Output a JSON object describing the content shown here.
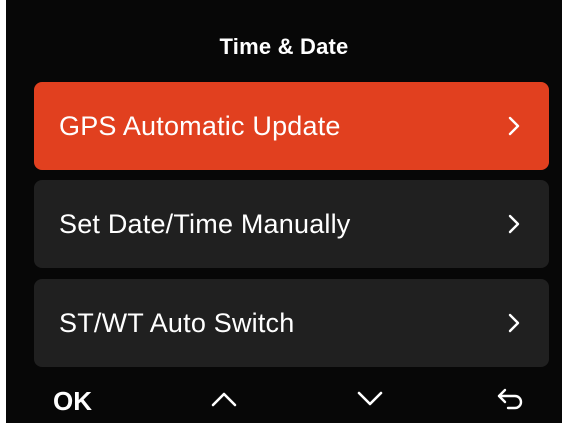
{
  "header": {
    "title": "Time & Date"
  },
  "menu": {
    "items": [
      {
        "label": "GPS Automatic Update",
        "selected": true
      },
      {
        "label": "Set Date/Time Manually",
        "selected": false
      },
      {
        "label": "ST/WT Auto Switch",
        "selected": false
      }
    ]
  },
  "softkeys": {
    "ok_label": "OK",
    "up_icon": "chevron-up-icon",
    "down_icon": "chevron-down-icon",
    "back_icon": "return-arrow-icon"
  },
  "colors": {
    "background": "#070707",
    "selected_item": "#e1401f",
    "item": "#202020",
    "text": "#ffffff"
  }
}
